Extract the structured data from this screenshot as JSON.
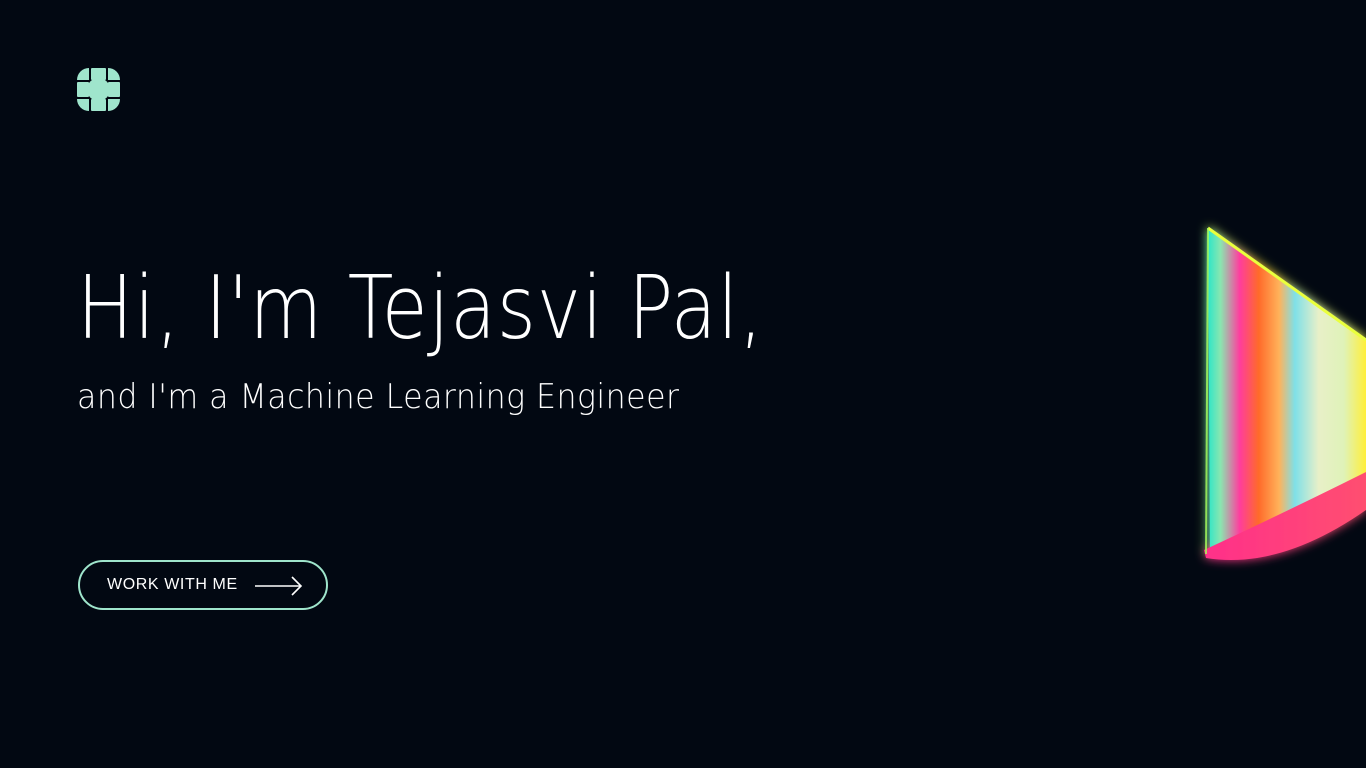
{
  "hero": {
    "headline": "Hi, I'm Tejasvi Pal,",
    "subheadline": "and I'm a Machine Learning Engineer"
  },
  "cta": {
    "label": "WORK WITH ME",
    "icon": "arrow-right-icon"
  },
  "logo": {
    "icon": "flower-logo-icon"
  },
  "decoration": {
    "icon": "gradient-cone-shape"
  },
  "colors": {
    "background": "#020812",
    "accent": "#9fe5cc",
    "text": "#ffffff"
  }
}
